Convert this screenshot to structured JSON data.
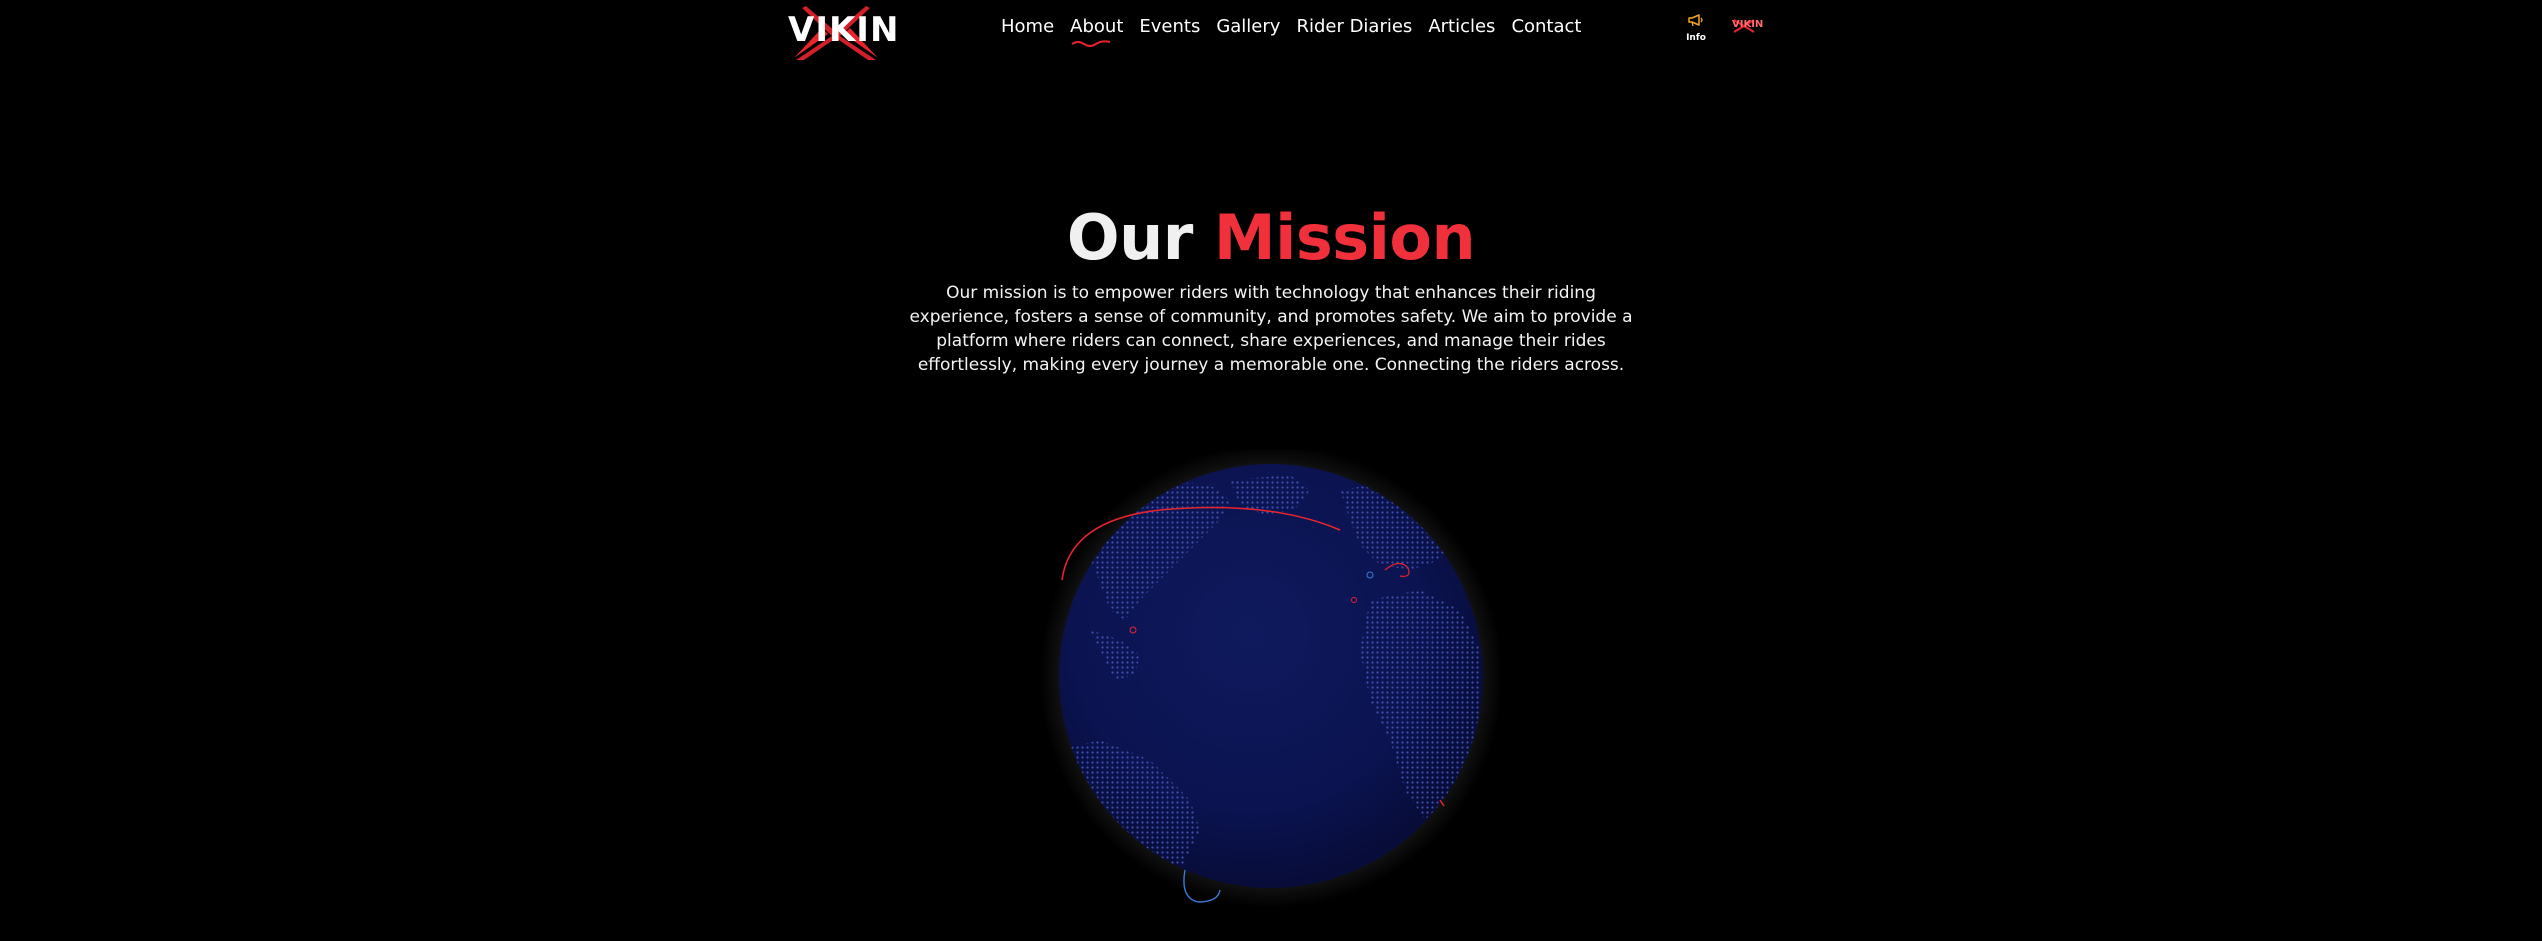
{
  "header": {
    "logo_text": "VIKIN",
    "nav": [
      {
        "label": "Home"
      },
      {
        "label": "About"
      },
      {
        "label": "Events"
      },
      {
        "label": "Gallery"
      },
      {
        "label": "Rider Diaries"
      },
      {
        "label": "Articles"
      },
      {
        "label": "Contact"
      }
    ],
    "active_nav": "About",
    "info_label": "Info",
    "small_logo_text": "VIKIN"
  },
  "hero": {
    "title_part1": "Our",
    "title_part2": "Mission",
    "text": "Our mission is to empower riders with technology that enhances their riding experience, fosters a sense of community, and promotes safety. We aim to provide a platform where riders can connect, share experiences, and manage their rides effortlessly, making every journey a memorable one. Connecting the riders across."
  },
  "colors": {
    "background": "#000000",
    "accent": "#f0303a",
    "globe": "#0c1450",
    "globe_dots": "#3a4aa8",
    "info_icon": "#f5a623"
  },
  "icons": {
    "info": "megaphone-icon",
    "globe": "globe-icon"
  }
}
